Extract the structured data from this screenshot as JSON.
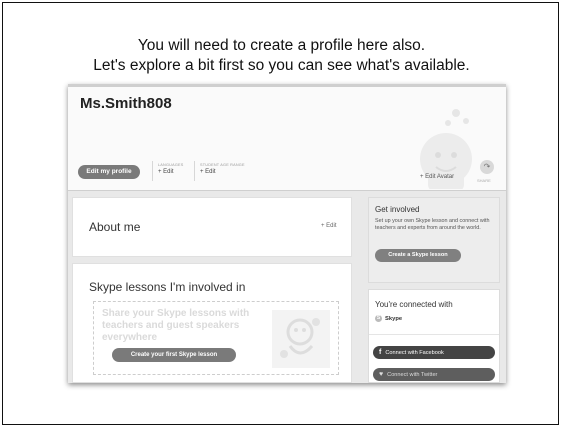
{
  "caption": {
    "line1": "You will need to create a profile here also.",
    "line2": "Let's explore a bit first so you can see what's available."
  },
  "profile": {
    "username": "Ms.Smith808",
    "edit_profile_label": "Edit my profile",
    "languages_caption": "LANGUAGES",
    "languages_edit": "+ Edit",
    "age_range_caption": "STUDENT AGE RANGE",
    "age_range_edit": "+ Edit",
    "edit_avatar": "+ Edit Avatar",
    "share_label": "SHARE"
  },
  "about": {
    "title": "About me",
    "edit": "+ Edit"
  },
  "lessons": {
    "title": "Skype lessons I'm involved in",
    "prompt": "Share your Skype lessons with teachers and guest speakers everywhere",
    "button": "Create your first Skype lesson"
  },
  "involved": {
    "title": "Get involved",
    "text": "Set up your own Skype lesson and connect with teachers and experts from around the world.",
    "button": "Create a Skype lesson"
  },
  "connected": {
    "title": "You're connected with",
    "skype_label": "Skype",
    "facebook_button": "Connect with Facebook",
    "twitter_button": "Connect with Twitter"
  },
  "icons": {
    "share": "share-arrow-icon",
    "skype": "skype-icon",
    "facebook": "facebook-icon",
    "twitter": "twitter-icon"
  },
  "colors": {
    "button_gray": "#7a7a7a",
    "panel_gray": "#ededed",
    "facebook_dark": "#444444"
  }
}
